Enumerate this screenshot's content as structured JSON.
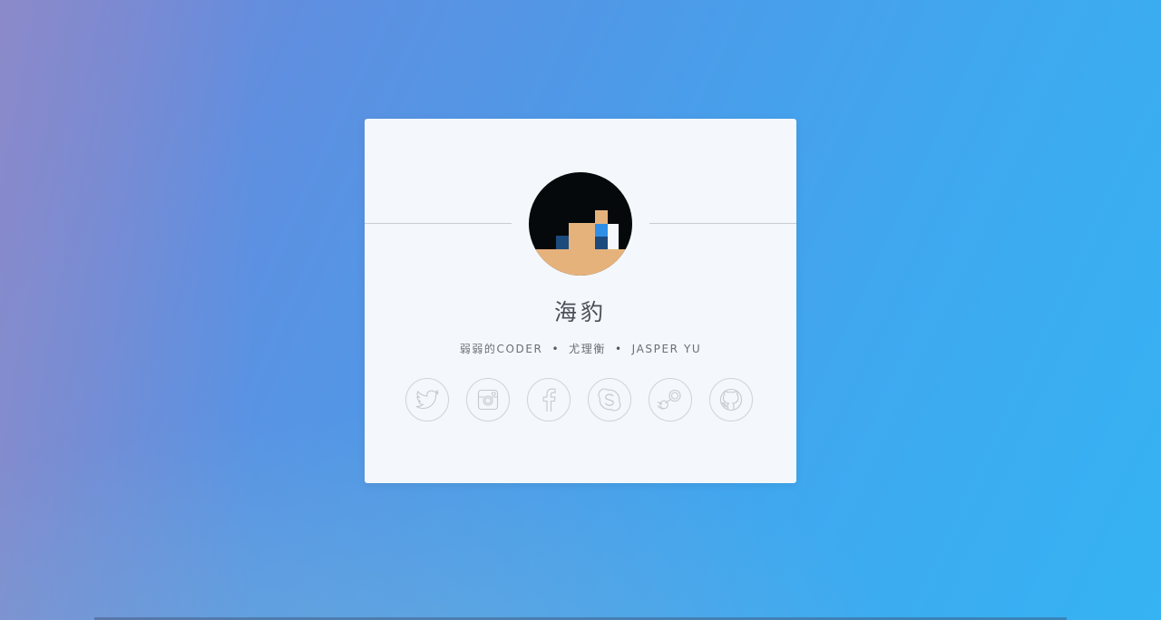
{
  "page": {
    "background_colors": [
      "#7d86d2",
      "#4d9ae8",
      "#35b3f3"
    ]
  },
  "profile": {
    "name": "海豹",
    "tagline_parts": [
      "弱弱的CODER",
      "尤理衡",
      "JASPER YU"
    ],
    "separator": "•"
  },
  "social_links": [
    {
      "icon": "twitter-icon"
    },
    {
      "icon": "instagram-icon"
    },
    {
      "icon": "facebook-icon"
    },
    {
      "icon": "skype-icon"
    },
    {
      "icon": "steam-icon"
    },
    {
      "icon": "github-icon"
    }
  ],
  "colors": {
    "card_bg": "#f4f8fc",
    "text": "#4a4f57",
    "icon_stroke": "#c5c9ce",
    "avatar_skin": "#e6b27c",
    "avatar_hair": "#05090c",
    "avatar_blue": "#2f8fe6",
    "avatar_dark_blue": "#1c4a7c"
  }
}
